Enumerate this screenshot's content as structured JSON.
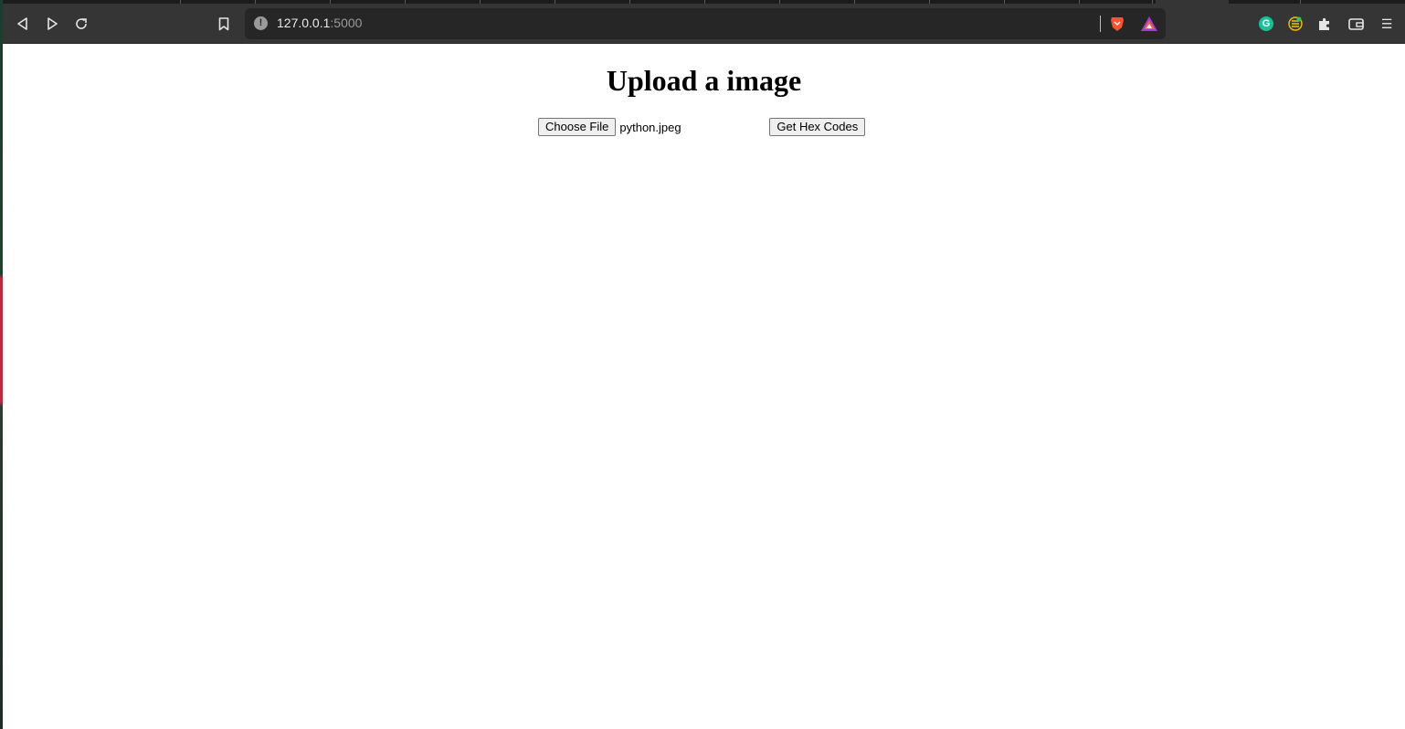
{
  "browser": {
    "url_host": "127.0.0.1",
    "url_port": ":5000",
    "menu_glyph": "☰",
    "icons": [
      "back-icon",
      "forward-icon",
      "reload-icon",
      "bookmark-icon",
      "info-icon",
      "brave-shield-icon",
      "brave-rewards-icon",
      "grammarly-icon",
      "extension-icon",
      "puzzle-icon",
      "wallet-icon",
      "menu-icon"
    ],
    "grammarly_letter": "G",
    "info_glyph": "!"
  },
  "page": {
    "title": "Upload a image",
    "file_button_label": "Choose File",
    "selected_file": "python.jpeg",
    "submit_label": "Get Hex Codes"
  },
  "colors": {
    "toolbar": "#353535",
    "urlbar": "#262626",
    "page_bg": "#ffffff",
    "grammarly": "#15c39a",
    "brave_orange": "#fb542b"
  }
}
